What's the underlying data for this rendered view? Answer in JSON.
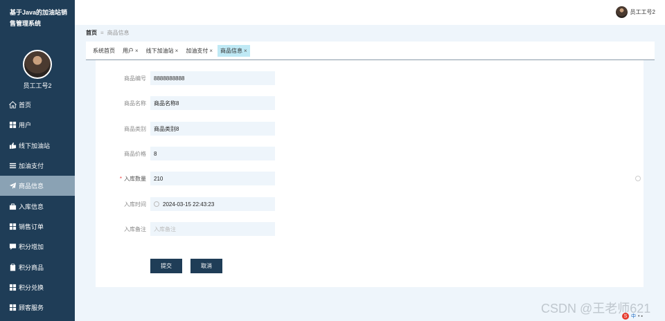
{
  "app": {
    "title": "基于Java的加油站销售管理系统",
    "user_name": "员工工号2"
  },
  "sidebar": {
    "items": [
      {
        "label": "首页",
        "icon": "home-icon"
      },
      {
        "label": "用户",
        "icon": "grid-icon"
      },
      {
        "label": "线下加油站",
        "icon": "thumb-icon"
      },
      {
        "label": "加油支付",
        "icon": "list-icon"
      },
      {
        "label": "商品信息",
        "icon": "send-icon",
        "active": true
      },
      {
        "label": "入库信息",
        "icon": "briefcase-icon"
      },
      {
        "label": "销售订单",
        "icon": "grid-icon"
      },
      {
        "label": "积分增加",
        "icon": "chat-icon"
      },
      {
        "label": "积分商品",
        "icon": "clipboard-icon"
      },
      {
        "label": "积分兑换",
        "icon": "grid-icon"
      },
      {
        "label": "顾客服务",
        "icon": "grid-icon"
      }
    ]
  },
  "header": {
    "user_name": "员工工号2"
  },
  "breadcrumb": {
    "home": "首页",
    "separator": "≡",
    "current": "商品信息"
  },
  "tabs": [
    {
      "label": "系统首页",
      "closable": false
    },
    {
      "label": "用户",
      "closable": true
    },
    {
      "label": "线下加油站",
      "closable": true
    },
    {
      "label": "加油支付",
      "closable": true
    },
    {
      "label": "商品信息",
      "closable": true,
      "active": true
    }
  ],
  "form": {
    "fields": [
      {
        "label": "商品编号",
        "value": "8888888888",
        "required": false
      },
      {
        "label": "商品名称",
        "value": "商品名称8",
        "required": false
      },
      {
        "label": "商品类别",
        "value": "商品类别8",
        "required": false
      },
      {
        "label": "商品价格",
        "value": "8",
        "required": false
      },
      {
        "label": "入库数量",
        "value": "210",
        "required": true
      },
      {
        "label": "入库时间",
        "value": "2024-03-15 22:43:23",
        "required": false
      },
      {
        "label": "入库备注",
        "value": "",
        "placeholder": "入库备注",
        "required": false
      }
    ],
    "submit_label": "提交",
    "cancel_label": "取消"
  },
  "watermark": "CSDN @王老师621",
  "tray": {
    "ime": "中"
  },
  "colors": {
    "sidebar_bg": "#1f3d57",
    "active_menu": "#8aa2b4",
    "active_tab": "#bfe9f5",
    "button_bg": "#1f3d57",
    "input_bg": "#eef5fb",
    "required": "#e44444"
  }
}
